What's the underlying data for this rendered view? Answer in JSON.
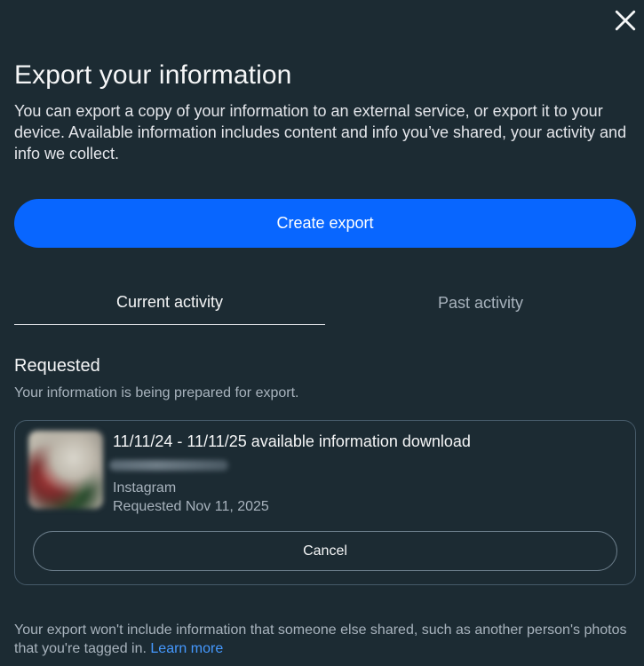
{
  "dialog": {
    "close_icon": "close-icon",
    "title": "Export your information",
    "description": "You can export a copy of your information to an external service, or export it to your device. Available information includes content and info you’ve shared, your activity and info we collect.",
    "create_button": "Create export"
  },
  "tabs": [
    {
      "label": "Current activity",
      "active": true
    },
    {
      "label": "Past activity",
      "active": false
    }
  ],
  "requested": {
    "title": "Requested",
    "subtitle": "Your information is being prepared for export.",
    "item": {
      "title": "11/11/24 - 11/11/25 available information download",
      "source": "Instagram",
      "requested_date": "Requested Nov 11, 2025",
      "cancel_label": "Cancel"
    }
  },
  "footer": {
    "text": "Your export won't include information that someone else shared, such as another person's photos that you're tagged in. ",
    "link": "Learn more"
  },
  "colors": {
    "background": "#1c2b33",
    "primary": "#0866ff",
    "link": "#4599ff"
  }
}
